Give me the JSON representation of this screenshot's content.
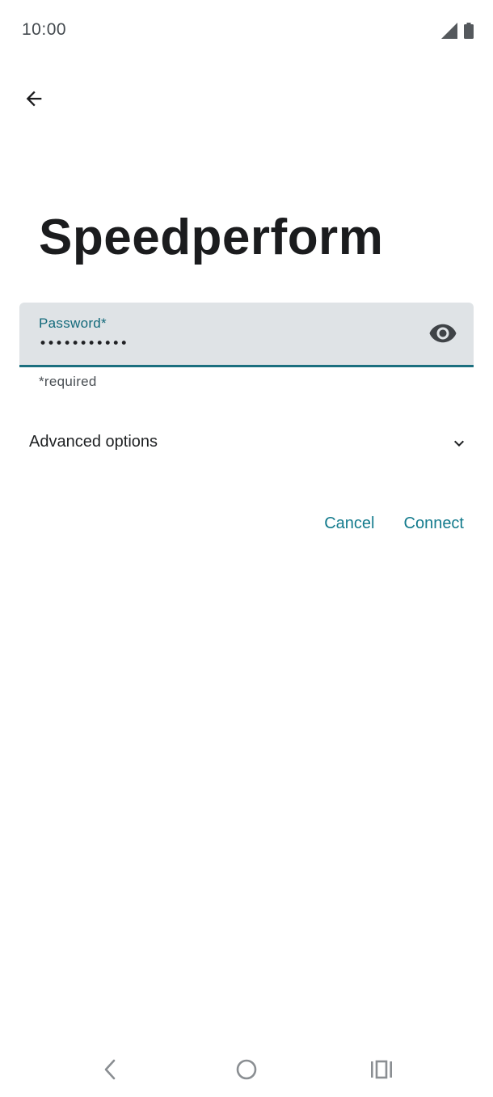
{
  "status_bar": {
    "time": "10:00",
    "icons": [
      "signal-icon",
      "battery-icon"
    ]
  },
  "header": {
    "back_icon": "arrow-left-icon"
  },
  "title": "Speedperform",
  "password_field": {
    "label": "Password*",
    "value": "•••••••••••",
    "toggle_icon": "eye-icon",
    "helper": "*required"
  },
  "advanced": {
    "label": "Advanced options",
    "icon": "chevron-down-icon"
  },
  "actions": {
    "cancel_label": "Cancel",
    "connect_label": "Connect"
  },
  "colors": {
    "accent": "#127a8c",
    "field_bg": "#dfe3e6",
    "underline": "#1b6f7f"
  },
  "nav_bar": {
    "icons": [
      "nav-back-icon",
      "nav-home-icon",
      "nav-recents-icon"
    ]
  }
}
